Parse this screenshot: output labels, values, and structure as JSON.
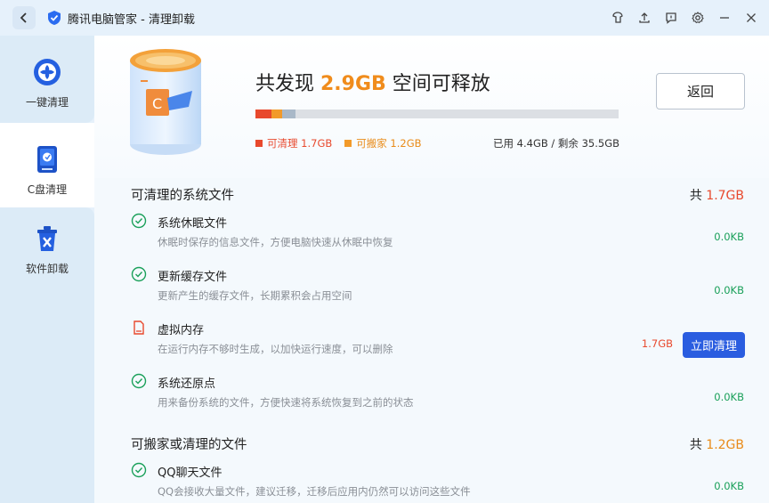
{
  "titlebar": {
    "title": "腾讯电脑管家 - 清理卸载"
  },
  "sidebar": {
    "items": [
      {
        "label": "一键清理"
      },
      {
        "label": "C盘清理"
      },
      {
        "label": "软件卸载"
      }
    ]
  },
  "hero": {
    "headline_prefix": "共发现 ",
    "headline_amount": "2.9GB",
    "headline_suffix": " 空间可释放",
    "return_button": "返回",
    "legend": {
      "cleanable": "可清理 1.7GB",
      "movable": "可搬家 1.2GB"
    },
    "usage": "已用 4.4GB / 剩余 35.5GB",
    "bar_fractions": {
      "cleanable": 0.044,
      "movable": 0.03,
      "other": 0.037
    }
  },
  "sections": [
    {
      "title": "可清理的系统文件",
      "total_prefix": "共 ",
      "total_value": "1.7GB",
      "items": [
        {
          "title": "系统休眠文件",
          "desc": "休眠时保存的信息文件，方便电脑快速从休眠中恢复",
          "size": "0.0KB"
        },
        {
          "title": "更新缓存文件",
          "desc": "更新产生的缓存文件，长期累积会占用空间",
          "size": "0.0KB"
        },
        {
          "title": "虚拟内存",
          "desc": "在运行内存不够时生成，以加快运行速度，可以删除",
          "size": "1.7GB",
          "action": "立即清理"
        },
        {
          "title": "系统还原点",
          "desc": "用来备份系统的文件，方便快速将系统恢复到之前的状态",
          "size": "0.0KB"
        }
      ]
    },
    {
      "title": "可搬家或清理的文件",
      "total_prefix": "共 ",
      "total_value": "1.2GB",
      "items": [
        {
          "title": "QQ聊天文件",
          "desc": "QQ会接收大量文件，建议迁移，迁移后应用内仍然可以访问这些文件",
          "size": "0.0KB"
        }
      ]
    }
  ],
  "colors": {
    "accent_blue": "#2a5de0",
    "cleanable_red": "#e8492d",
    "movable_orange": "#e98b18",
    "ok_green": "#1aa05a"
  }
}
